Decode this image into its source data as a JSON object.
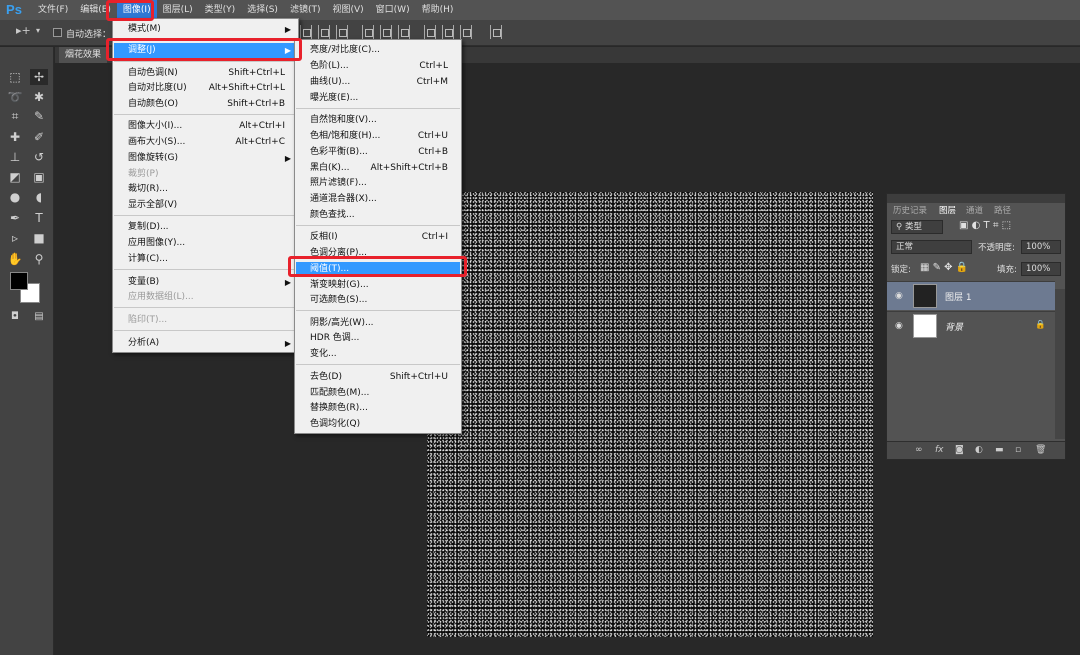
{
  "app": {
    "logo": "Ps"
  },
  "menubar": {
    "items": [
      {
        "label": "文件(F)"
      },
      {
        "label": "编辑(E)"
      },
      {
        "label": "图像(I)"
      },
      {
        "label": "图层(L)"
      },
      {
        "label": "类型(Y)"
      },
      {
        "label": "选择(S)"
      },
      {
        "label": "滤镜(T)"
      },
      {
        "label": "视图(V)"
      },
      {
        "label": "窗口(W)"
      },
      {
        "label": "帮助(H)"
      }
    ]
  },
  "options_bar": {
    "auto_select_label": "自动选择："
  },
  "document": {
    "tab_label": "烟花效果"
  },
  "image_menu": {
    "items": [
      {
        "label": "模式(M)",
        "shortcut": "",
        "submenu": true
      },
      {
        "label": "调整(J)",
        "shortcut": "",
        "submenu": true
      },
      {
        "label": "自动色调(N)",
        "shortcut": "Shift+Ctrl+L"
      },
      {
        "label": "自动对比度(U)",
        "shortcut": "Alt+Shift+Ctrl+L"
      },
      {
        "label": "自动颜色(O)",
        "shortcut": "Shift+Ctrl+B"
      },
      {
        "label": "图像大小(I)...",
        "shortcut": "Alt+Ctrl+I"
      },
      {
        "label": "画布大小(S)...",
        "shortcut": "Alt+Ctrl+C"
      },
      {
        "label": "图像旋转(G)",
        "shortcut": "",
        "submenu": true
      },
      {
        "label": "裁剪(P)",
        "shortcut": "",
        "disabled": true
      },
      {
        "label": "裁切(R)...",
        "shortcut": ""
      },
      {
        "label": "显示全部(V)",
        "shortcut": ""
      },
      {
        "label": "复制(D)...",
        "shortcut": ""
      },
      {
        "label": "应用图像(Y)...",
        "shortcut": ""
      },
      {
        "label": "计算(C)...",
        "shortcut": ""
      },
      {
        "label": "变量(B)",
        "shortcut": "",
        "submenu": true
      },
      {
        "label": "应用数据组(L)...",
        "shortcut": "",
        "disabled": true
      },
      {
        "label": "陷印(T)...",
        "shortcut": "",
        "disabled": true
      },
      {
        "label": "分析(A)",
        "shortcut": "",
        "submenu": true
      }
    ]
  },
  "adjust_menu": {
    "items": [
      {
        "label": "亮度/对比度(C)...",
        "shortcut": ""
      },
      {
        "label": "色阶(L)...",
        "shortcut": "Ctrl+L"
      },
      {
        "label": "曲线(U)...",
        "shortcut": "Ctrl+M"
      },
      {
        "label": "曝光度(E)...",
        "shortcut": ""
      },
      {
        "label": "自然饱和度(V)...",
        "shortcut": ""
      },
      {
        "label": "色相/饱和度(H)...",
        "shortcut": "Ctrl+U"
      },
      {
        "label": "色彩平衡(B)...",
        "shortcut": "Ctrl+B"
      },
      {
        "label": "黑白(K)...",
        "shortcut": "Alt+Shift+Ctrl+B"
      },
      {
        "label": "照片滤镜(F)...",
        "shortcut": ""
      },
      {
        "label": "通道混合器(X)...",
        "shortcut": ""
      },
      {
        "label": "颜色查找...",
        "shortcut": ""
      },
      {
        "label": "反相(I)",
        "shortcut": "Ctrl+I"
      },
      {
        "label": "色调分离(P)...",
        "shortcut": ""
      },
      {
        "label": "阈值(T)...",
        "shortcut": ""
      },
      {
        "label": "渐变映射(G)...",
        "shortcut": ""
      },
      {
        "label": "可选颜色(S)...",
        "shortcut": ""
      },
      {
        "label": "阴影/高光(W)...",
        "shortcut": ""
      },
      {
        "label": "HDR 色调...",
        "shortcut": ""
      },
      {
        "label": "变化...",
        "shortcut": ""
      },
      {
        "label": "去色(D)",
        "shortcut": "Shift+Ctrl+U"
      },
      {
        "label": "匹配颜色(M)...",
        "shortcut": ""
      },
      {
        "label": "替换颜色(R)...",
        "shortcut": ""
      },
      {
        "label": "色调均化(Q)",
        "shortcut": ""
      }
    ]
  },
  "layers_panel": {
    "tabs": [
      {
        "label": "历史记录"
      },
      {
        "label": "图层"
      },
      {
        "label": "通道"
      },
      {
        "label": "路径"
      }
    ],
    "filter_label": "类型",
    "blend_mode": "正常",
    "opacity_label": "不透明度:",
    "opacity_value": "100%",
    "lock_label": "锁定:",
    "fill_label": "填充:",
    "fill_value": "100%",
    "layers": [
      {
        "name": "图层 1"
      },
      {
        "name": "背景"
      }
    ]
  },
  "colors": {
    "highlight": "#3399ff",
    "annotation_red": "#e8212b",
    "foreground": "#000000",
    "background": "#ffffff"
  }
}
